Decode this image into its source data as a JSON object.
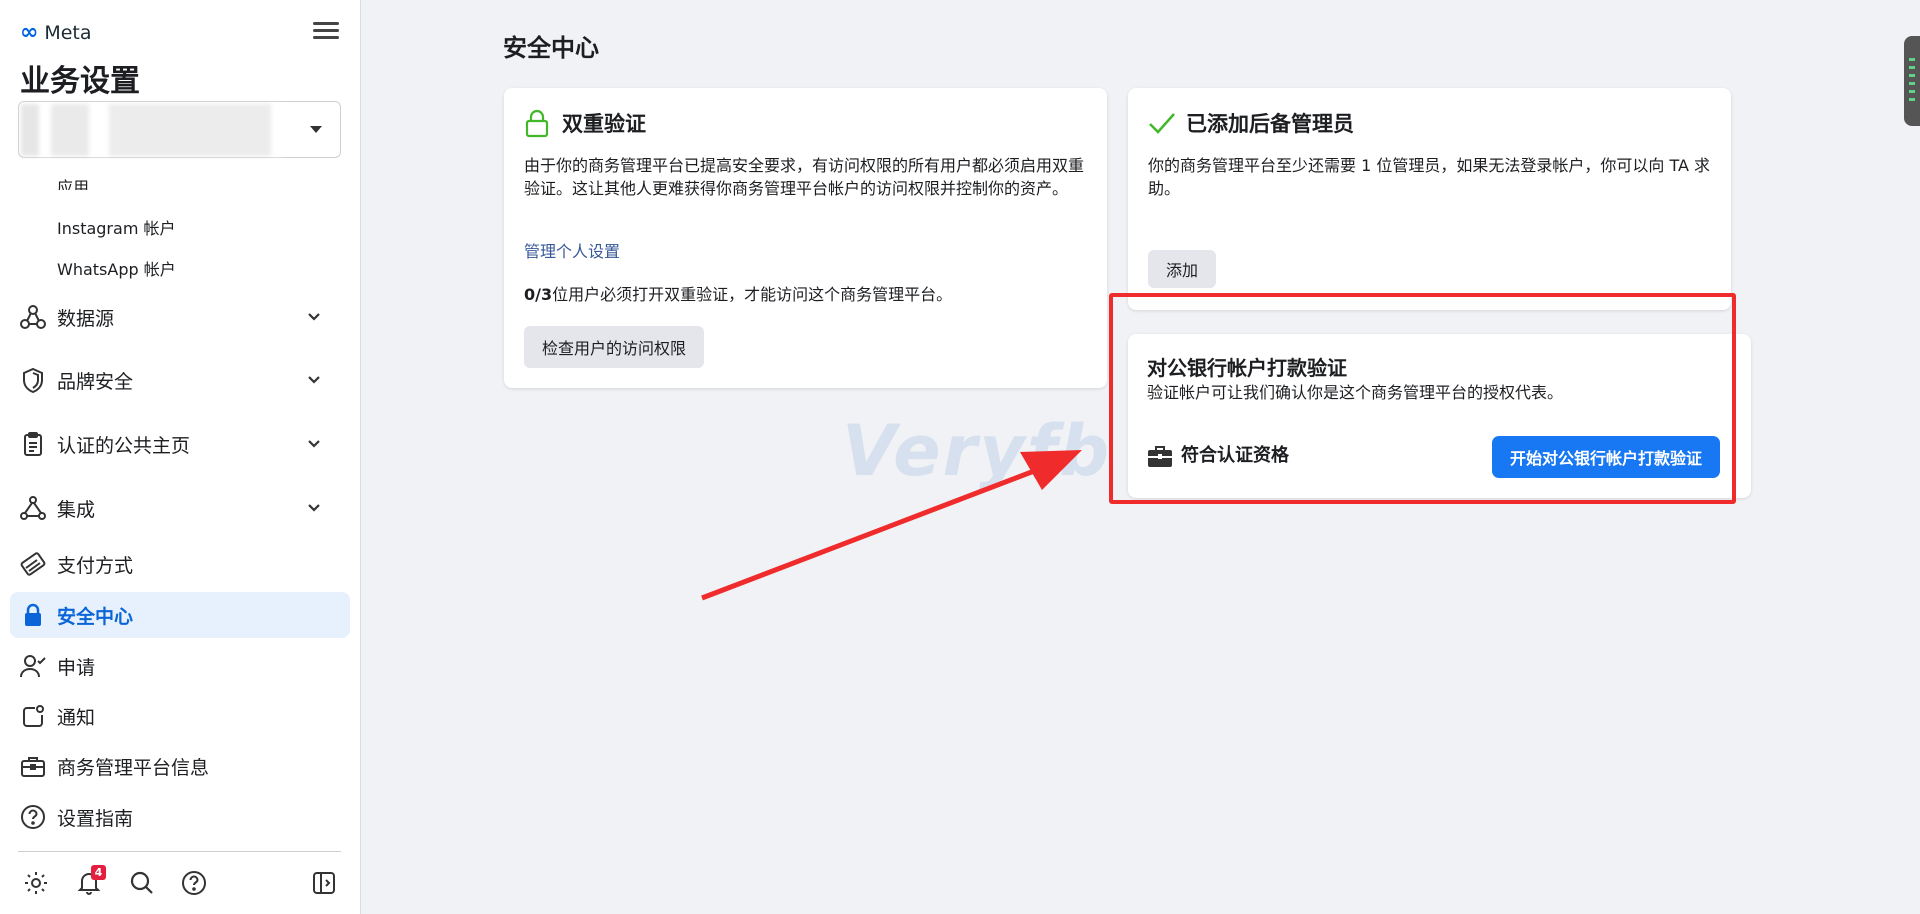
{
  "brand": {
    "name": "Meta",
    "logo": "∞"
  },
  "sidebar": {
    "heading": "业务设置",
    "sub_items": [
      "应用",
      "Instagram 帐户",
      "WhatsApp 帐户"
    ],
    "nav": [
      {
        "label": "数据源",
        "icon": "data-sources-icon",
        "expandable": true
      },
      {
        "label": "品牌安全",
        "icon": "shield-icon",
        "expandable": true
      },
      {
        "label": "认证的公共主页",
        "icon": "clipboard-icon",
        "expandable": true
      },
      {
        "label": "集成",
        "icon": "integration-icon",
        "expandable": true
      },
      {
        "label": "支付方式",
        "icon": "card-icon",
        "expandable": false
      },
      {
        "label": "安全中心",
        "icon": "lock-icon",
        "expandable": false,
        "active": true
      },
      {
        "label": "申请",
        "icon": "person-check-icon",
        "expandable": false
      },
      {
        "label": "通知",
        "icon": "notification-icon",
        "expandable": false
      },
      {
        "label": "商务管理平台信息",
        "icon": "briefcase-icon",
        "expandable": false
      },
      {
        "label": "设置指南",
        "icon": "question-icon",
        "expandable": false
      }
    ],
    "notification_count": "4"
  },
  "main": {
    "title": "安全中心",
    "two_factor": {
      "title": "双重验证",
      "description": "由于你的商务管理平台已提高安全要求，有访问权限的所有用户都必须启用双重验证。这让其他人更难获得你商务管理平台帐户的访问权限并控制你的资产。",
      "link": "管理个人设置",
      "status_count": "0/3",
      "status_text": "位用户必须打开双重验证，才能访问这个商务管理平台。",
      "button": "检查用户的访问权限"
    },
    "backup_admin": {
      "title": "已添加后备管理员",
      "description": "你的商务管理平台至少还需要 1 位管理员，如果无法登录帐户，你可以向 TA 求助。",
      "button": "添加"
    },
    "bank_verify": {
      "title": "对公银行帐户打款验证",
      "description": "验证帐户可让我们确认你是这个商务管理平台的授权代表。",
      "eligibility": "符合认证资格",
      "button": "开始对公银行帐户打款验证"
    },
    "watermark": "Veryfb"
  },
  "colors": {
    "accent": "#1877f2",
    "highlight": "#ef2b2b",
    "success": "#42b72a"
  }
}
